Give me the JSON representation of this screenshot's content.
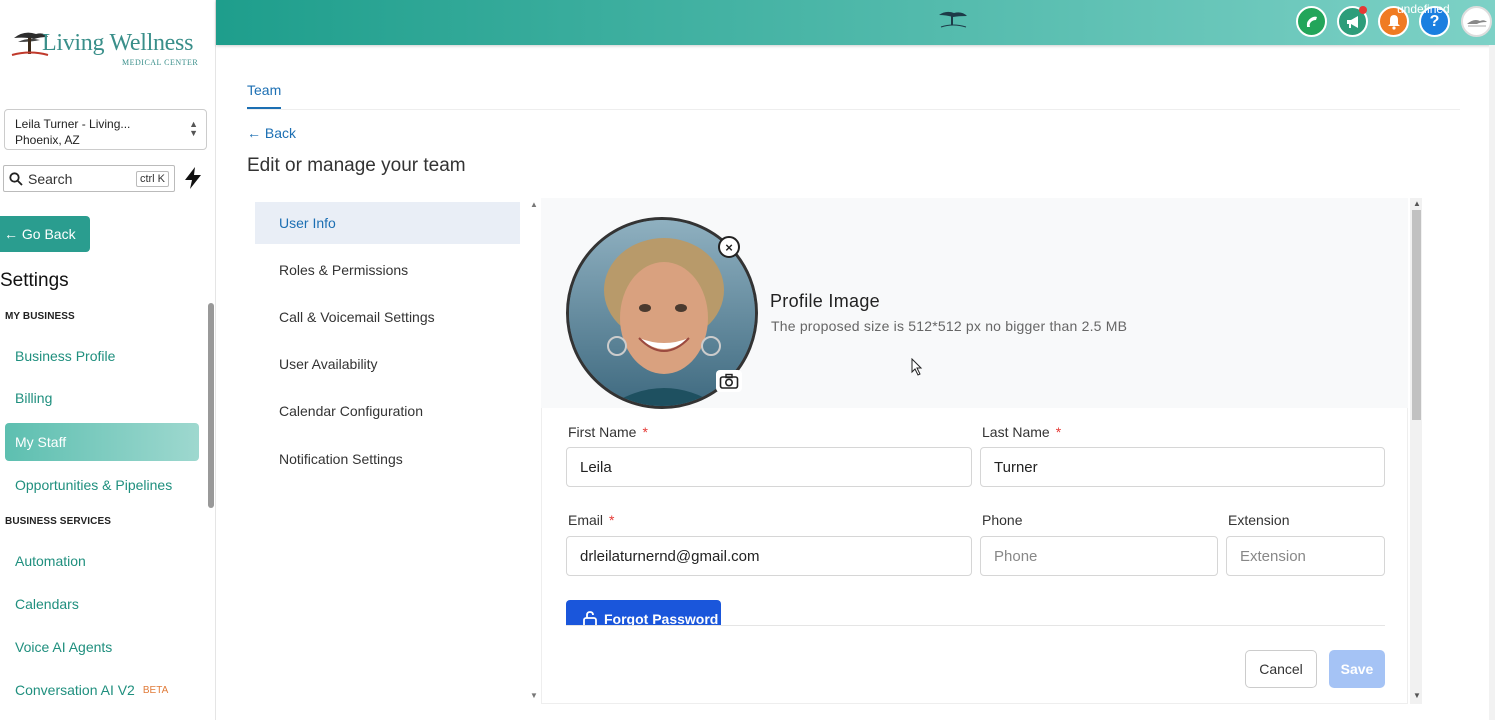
{
  "brand": {
    "name": "Living Wellness",
    "tagline": "MEDICAL CENTER"
  },
  "sidebar": {
    "location_line1": "Leila Turner - Living...",
    "location_line2": "Phoenix, AZ",
    "search_placeholder": "Search",
    "search_shortcut": "ctrl K",
    "go_back": "← Go Back",
    "settings_title": "Settings",
    "section_my_business": "MY BUSINESS",
    "section_business_services": "BUSINESS SERVICES",
    "items": [
      {
        "label": "Business Profile"
      },
      {
        "label": "Billing"
      },
      {
        "label": "My Staff"
      },
      {
        "label": "Opportunities & Pipelines"
      },
      {
        "label": "Automation"
      },
      {
        "label": "Calendars"
      },
      {
        "label": "Voice AI Agents"
      },
      {
        "label": "Conversation AI V2",
        "badge": "BETA"
      }
    ]
  },
  "topbar": {
    "undefined_label": "undefined"
  },
  "tabs": {
    "team": "Team"
  },
  "back_label": "Back",
  "page_title": "Edit or manage your team",
  "menu": [
    {
      "label": "User Info"
    },
    {
      "label": "Roles & Permissions"
    },
    {
      "label": "Call & Voicemail Settings"
    },
    {
      "label": "User Availability"
    },
    {
      "label": "Calendar Configuration"
    },
    {
      "label": "Notification Settings"
    }
  ],
  "profile": {
    "title": "Profile Image",
    "subtitle": "The proposed size is 512*512 px no bigger than 2.5 MB"
  },
  "form": {
    "first_name_label": "First Name",
    "first_name_value": "Leila",
    "last_name_label": "Last Name",
    "last_name_value": "Turner",
    "email_label": "Email",
    "email_value": "drleilaturnernd@gmail.com",
    "phone_label": "Phone",
    "phone_placeholder": "Phone",
    "extension_label": "Extension",
    "extension_placeholder": "Extension",
    "required_mark": "*",
    "forgot_password": "Forgot Password"
  },
  "actions": {
    "cancel": "Cancel",
    "save": "Save"
  },
  "colors": {
    "accent": "#1e9e8c",
    "link": "#1c6fb3",
    "primary_button": "#1a56db",
    "save_disabled": "#a5c3f5"
  },
  "icons": [
    "search-icon",
    "bolt-icon",
    "phone-icon",
    "megaphone-icon",
    "bell-icon",
    "help-icon",
    "close-icon",
    "camera-icon",
    "lock-icon"
  ]
}
